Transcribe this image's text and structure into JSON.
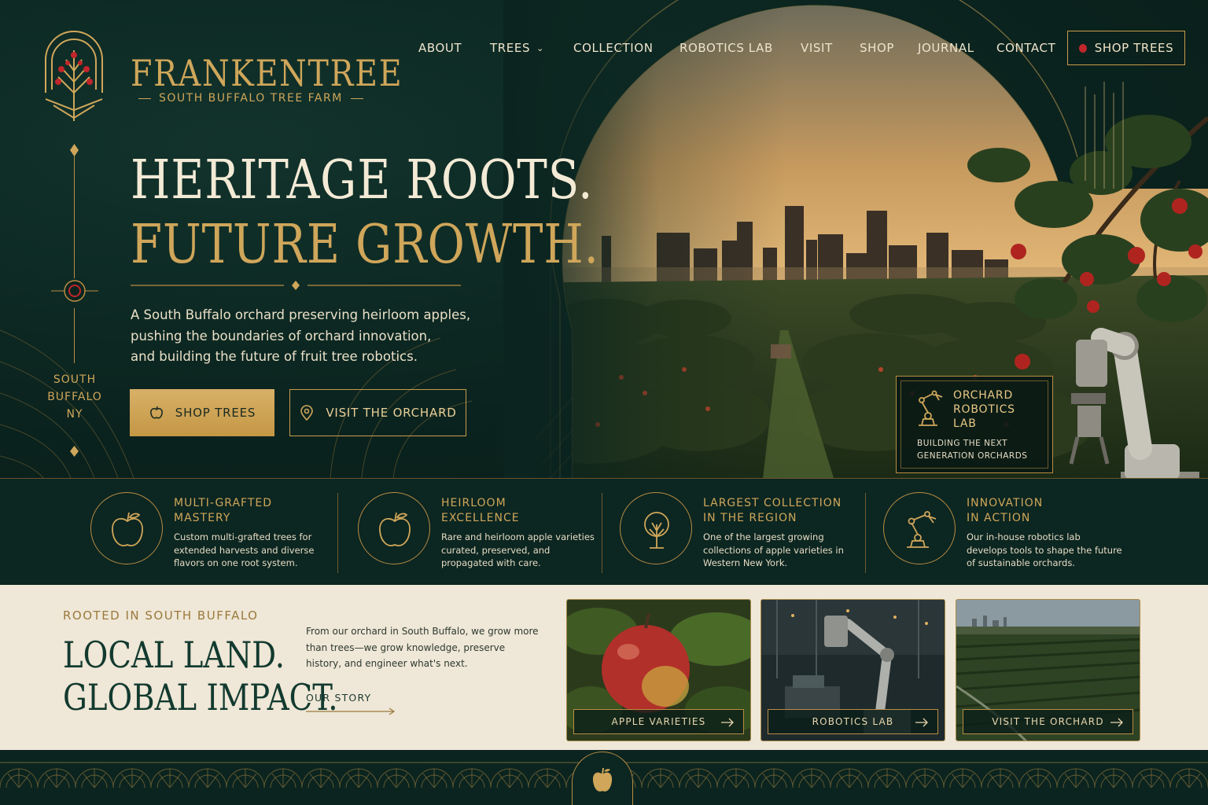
{
  "brand": {
    "name": "FRANKENTREE",
    "tagline": "SOUTH BUFFALO TREE FARM"
  },
  "nav": {
    "items": [
      "ABOUT",
      "TREES",
      "COLLECTION",
      "ROBOTICS LAB",
      "VISIT",
      "SHOP",
      "JOURNAL",
      "CONTACT"
    ],
    "cta_label": "SHOP TREES"
  },
  "rail": {
    "location_lines": [
      "SOUTH",
      "BUFFALO",
      "NY"
    ]
  },
  "hero": {
    "headline_line1": "HERITAGE ROOTS.",
    "headline_line2": "FUTURE GROWTH.",
    "intro_lines": [
      "A South Buffalo orchard preserving heirloom apples,",
      "pushing the boundaries of orchard innovation,",
      "and building the future of fruit tree robotics."
    ],
    "primary_button": "SHOP TREES",
    "secondary_button": "VISIT THE ORCHARD"
  },
  "robotics_card": {
    "title_lines": [
      "ORCHARD",
      "ROBOTICS",
      "LAB"
    ],
    "subtitle_lines": [
      "BUILDING THE NEXT",
      "GENERATION ORCHARDS"
    ]
  },
  "features": [
    {
      "icon": "apple-icon",
      "title": "MULTI-GRAFTED\nMASTERY",
      "description": "Custom multi-grafted trees for extended harvests and diverse flavors on one root system."
    },
    {
      "icon": "apple-icon",
      "title": "HEIRLOOM\nEXCELLENCE",
      "description": "Rare and heirloom apple varieties curated, preserved, and propagated with care."
    },
    {
      "icon": "tree-icon",
      "title": "LARGEST COLLECTION\nIN THE REGION",
      "description": "One of the largest growing collections of apple varieties in Western New York."
    },
    {
      "icon": "robot-arm-icon",
      "title": "INNOVATION\nIN ACTION",
      "description": "Our in-house robotics lab develops tools to shape the future of sustainable orchards."
    }
  ],
  "story": {
    "eyebrow": "ROOTED IN SOUTH BUFFALO",
    "heading_line1": "LOCAL LAND.",
    "heading_line2": "GLOBAL IMPACT.",
    "paragraph": "From our orchard in South Buffalo, we grow more than trees—we grow knowledge, preserve history, and engineer what's next.",
    "link_label": "OUR STORY"
  },
  "tiles": [
    {
      "label": "APPLE VARIETIES"
    },
    {
      "label": "ROBOTICS LAB"
    },
    {
      "label": "VISIT THE ORCHARD"
    }
  ],
  "colors": {
    "deep_green": "#0b241f",
    "gold": "#cfa65a",
    "cream": "#efe7d7",
    "apple_red": "#c0262a"
  }
}
